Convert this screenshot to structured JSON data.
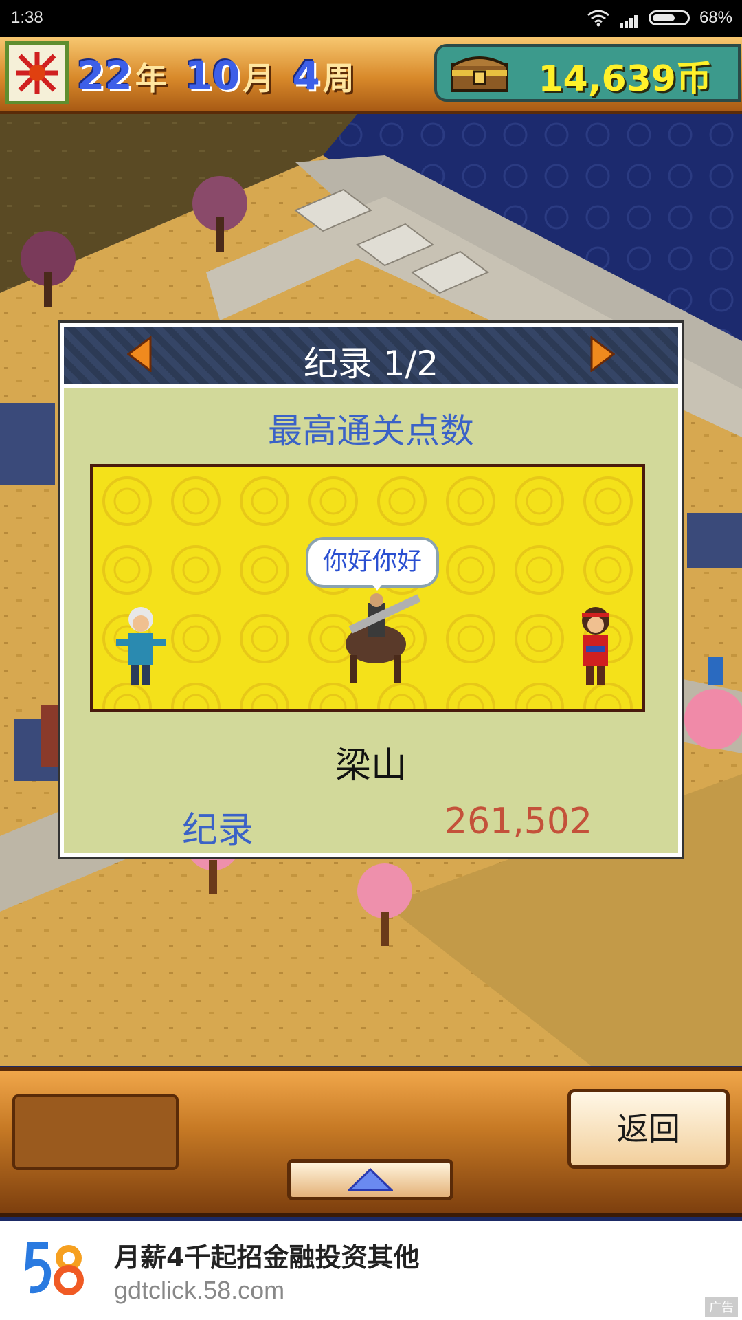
{
  "status_bar": {
    "time": "1:38",
    "battery": "68%"
  },
  "hud": {
    "year": "22",
    "year_unit": "年",
    "month": "10",
    "month_unit": "月",
    "week": "4",
    "week_unit": "周",
    "coins": "14,639币"
  },
  "dialog": {
    "title": "纪录 1/2",
    "subtitle": "最高通关点数",
    "speech": "你好你好",
    "team_name": "梁山",
    "record_label": "纪录",
    "record_value": "261,502"
  },
  "bottom_bar": {
    "back_label": "返回"
  },
  "ad": {
    "title": "月薪4千起招金融投资其他",
    "url": "gdtclick.58.com",
    "tag": "广告"
  },
  "icons": {
    "prev": "arrow-left-icon",
    "next": "arrow-right-icon",
    "up": "triangle-up-icon",
    "coins": "treasure-chest-icon"
  },
  "colors": {
    "accent": "#3b62c7",
    "record": "#c4513a",
    "coins": "#fff12a"
  }
}
